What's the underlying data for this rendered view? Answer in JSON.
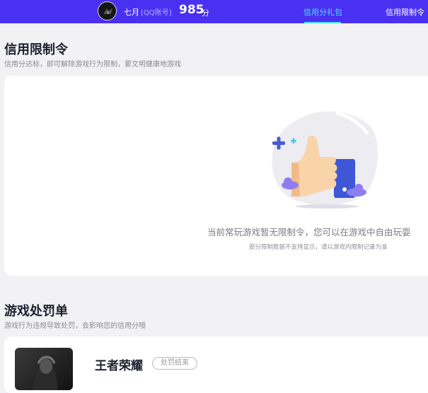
{
  "header": {
    "username": "七月",
    "account_label": "[QQ账号]",
    "score": "985",
    "score_unit": "分",
    "tabs": [
      {
        "label": "信用分礼包",
        "active": true
      },
      {
        "label": "信用限制令",
        "active": false
      }
    ],
    "colors": {
      "bar": "#4a30f0",
      "active_tab": "#4ee0ff"
    }
  },
  "restriction": {
    "title": "信用限制令",
    "subtitle": "信用分达标，即可解除游戏行为限制，要文明健康地游戏",
    "empty_main": "当前常玩游戏暂无限制令，您可以在游戏中自由玩耍",
    "empty_sub": "部分限制数据不支持显示，请以游戏内限制记录为准",
    "illustration_icon": "thumbs-up-icon"
  },
  "penalty": {
    "title": "游戏处罚单",
    "subtitle": "游戏行为违规导致处罚，会影响您的信用分哦",
    "items": [
      {
        "game": "王者荣耀",
        "status": "处罚结束"
      }
    ]
  }
}
